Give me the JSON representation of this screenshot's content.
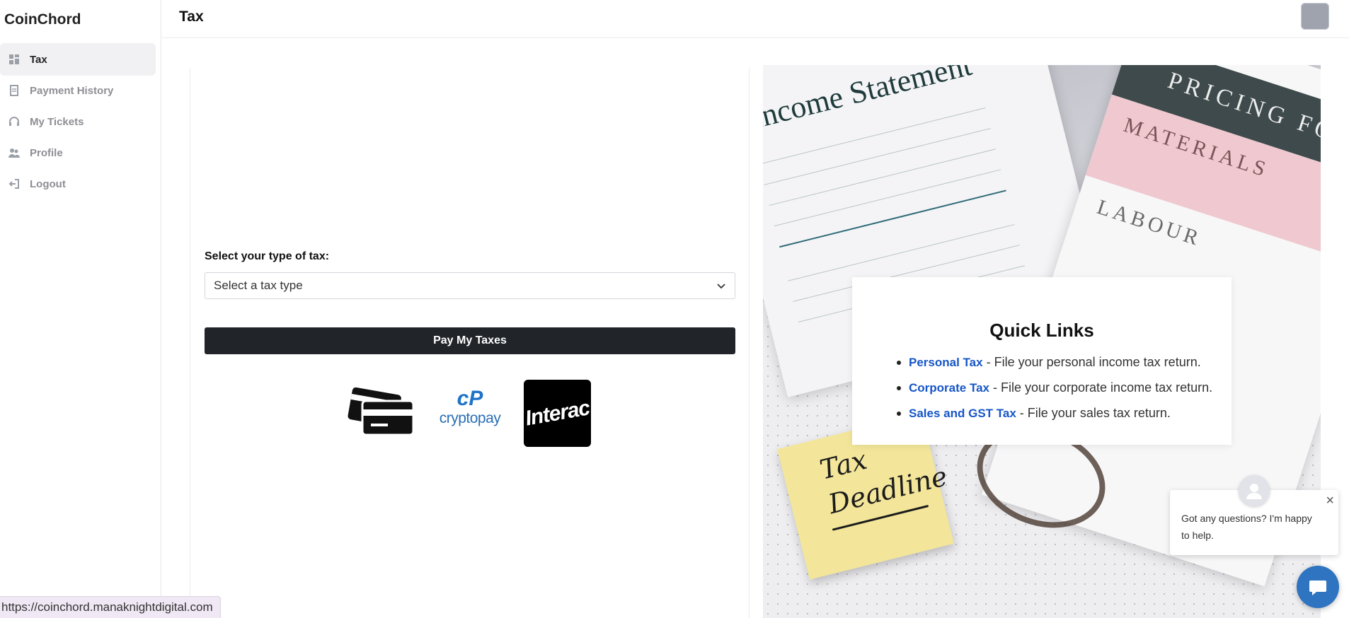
{
  "app": {
    "brand": "CoinChord"
  },
  "sidebar": {
    "items": [
      {
        "label": "Tax",
        "icon": "grid-icon",
        "active": true
      },
      {
        "label": "Payment History",
        "icon": "receipt-icon",
        "active": false
      },
      {
        "label": "My Tickets",
        "icon": "headset-icon",
        "active": false
      },
      {
        "label": "Profile",
        "icon": "users-icon",
        "active": false
      },
      {
        "label": "Logout",
        "icon": "logout-icon",
        "active": false
      }
    ]
  },
  "header": {
    "title": "Tax"
  },
  "form": {
    "label": "Select your type of tax:",
    "select_value": "Select a tax type",
    "pay_button": "Pay My Taxes"
  },
  "payment_methods": {
    "cryptopay_text": "cryptopay",
    "cryptopay_mark": "cP",
    "interac_text": "Interac"
  },
  "hero_image": {
    "doc_title": "Income Statement",
    "pricing_text": "PRICING FO",
    "materials_text": "MATERIALS",
    "labour_text": "LABOUR",
    "sticky_line1": "Tax",
    "sticky_line2": "Deadline"
  },
  "quick_links": {
    "title": "Quick Links",
    "items": [
      {
        "link": "Personal Tax",
        "desc": " - File your personal income tax return."
      },
      {
        "link": "Corporate Tax",
        "desc": " - File your corporate income tax return."
      },
      {
        "link": "Sales and GST Tax",
        "desc": " - File your sales tax return."
      }
    ]
  },
  "chat": {
    "message": "Got any questions? I'm happy to help.",
    "close": "×"
  },
  "status_url": "https://coinchord.manaknightdigital.com",
  "colors": {
    "primary_button": "#212529",
    "link": "#1656c7",
    "chat": "#2f74c0"
  }
}
